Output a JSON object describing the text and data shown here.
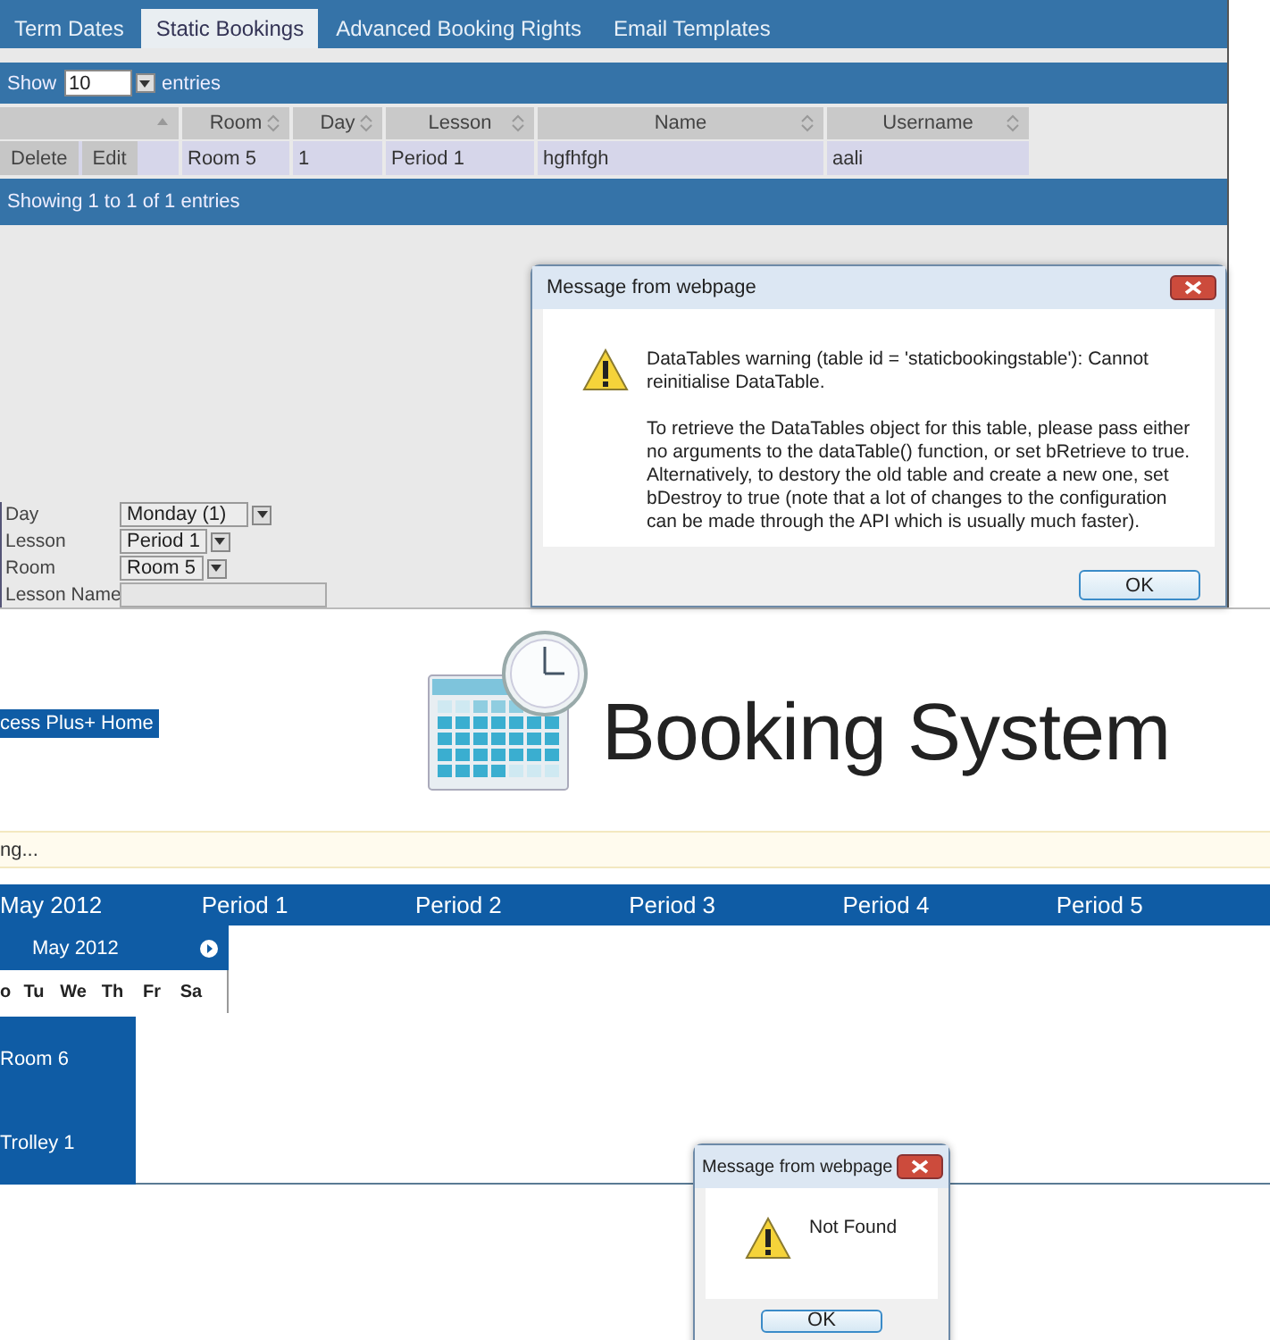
{
  "admin": {
    "tabs": [
      {
        "label": "Term Dates",
        "selected": false
      },
      {
        "label": "Static Bookings",
        "selected": true
      },
      {
        "label": "Advanced Booking Rights",
        "selected": false
      },
      {
        "label": "Email Templates",
        "selected": false
      }
    ],
    "length_menu": {
      "label_before": "Show",
      "value": "10",
      "label_after": "entries"
    },
    "table": {
      "columns": [
        {
          "sorted": true
        },
        {
          "label": "Room",
          "sorted": false
        },
        {
          "label": "Day",
          "sorted": false
        },
        {
          "label": "Lesson",
          "sorted": false
        },
        {
          "label": "Name",
          "sorted": false
        },
        {
          "label": "Username",
          "sorted": false
        }
      ],
      "rows": [
        {
          "cells": [
            [
              "Delete",
              "Edit"
            ],
            "Room 5",
            "1",
            "Period 1",
            "hgfhfgh",
            "aali"
          ]
        }
      ]
    },
    "info": "Showing 1 to 1 of 1 entries",
    "form": [
      {
        "label": "Day",
        "kind": "select",
        "value": "Monday (1)"
      },
      {
        "label": "Lesson",
        "kind": "select",
        "value": "Period 1"
      },
      {
        "label": "Room",
        "kind": "select",
        "value": "Room 5"
      },
      {
        "label": "Lesson Name",
        "kind": "text"
      }
    ]
  },
  "booking": {
    "home_button": "cess Plus+ Home",
    "title": "Booking System",
    "status": "ng...",
    "month": "May 2012",
    "periods": [
      "Period 1",
      "Period 2",
      "Period 3",
      "Period 4",
      "Period 5"
    ],
    "mini_calendar": {
      "month": "May 2012",
      "weekdays": [
        "o",
        "Tu",
        "We",
        "Th",
        "Fr",
        "Sa"
      ]
    },
    "rooms": [
      "Room 6",
      "Trolley 1"
    ]
  },
  "dialogs": [
    {
      "title": "Message from webpage",
      "paragraphs": [
        "DataTables warning (table id = 'staticbookingstable'): Cannot reinitialise DataTable.",
        "To retrieve the DataTables object for this table, please pass either no arguments to the dataTable() function, or set bRetrieve to true. Alternatively, to destory the old table and create a new one, set bDestroy to true (note that a lot of changes to the configuration can be made through the API which is usually much faster)."
      ],
      "button": "OK"
    },
    {
      "title": "Message from webpage",
      "paragraphs": [
        "Not Found"
      ],
      "button": "OK"
    }
  ]
}
